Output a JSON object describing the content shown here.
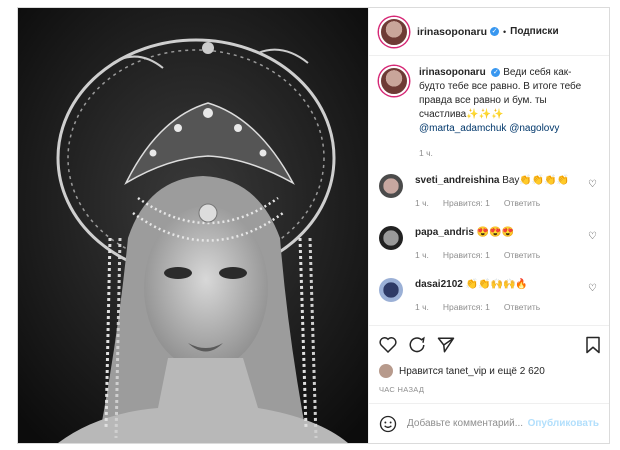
{
  "post": {
    "author": "irinasoponaru",
    "follow_label": "Подписки",
    "caption": {
      "text": "Веди себя как-будто тебе все равно. В итоге тебе правда все равно и бум. ты счастлива✨✨✨",
      "mentions": "@marta_adamchuk @nagolovy",
      "time": "1 ч."
    },
    "comments": [
      {
        "user": "sveti_andreishina",
        "text": "Вау👏👏👏👏",
        "time": "1 ч.",
        "likes": "Нравится: 1",
        "reply": "Ответить"
      },
      {
        "user": "papa_andris",
        "text": "😍😍😍",
        "time": "1 ч.",
        "likes": "Нравится: 1",
        "reply": "Ответить"
      },
      {
        "user": "dasai2102",
        "text": "👏👏🙌🙌🔥",
        "time": "1 ч.",
        "likes": "Нравится: 1",
        "reply": "Ответить"
      }
    ],
    "likes_text": "Нравится tanet_vip и ещё 2 620",
    "posted_ago": "ЧАС НАЗАД",
    "comment_placeholder": "Добавьте комментарий...",
    "publish_label": "Опубликовать"
  },
  "colors": {
    "link": "#00376b",
    "verified": "#3897f0",
    "publish_disabled": "#b2dffc"
  },
  "icons": [
    "verified-icon",
    "heart-icon",
    "comment-icon",
    "share-icon",
    "bookmark-icon",
    "emoji-icon"
  ]
}
